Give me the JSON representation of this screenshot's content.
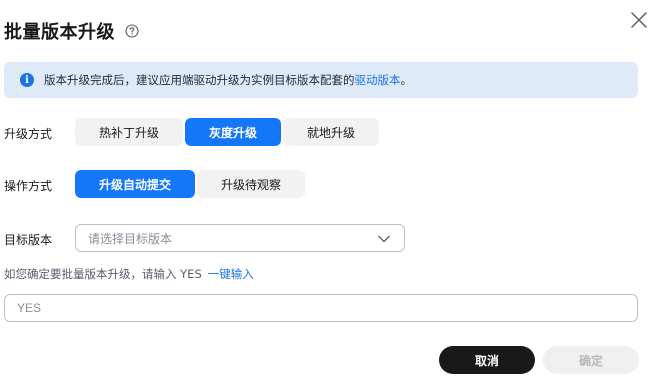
{
  "dialog": {
    "title": "批量版本升级",
    "alert": {
      "text": "版本升级完成后，建议应用端驱动升级为实例目标版本配套的",
      "link": "驱动版本",
      "suffix": "。"
    },
    "upgrade_method": {
      "label": "升级方式",
      "options": [
        "热补丁升级",
        "灰度升级",
        "就地升级"
      ],
      "selected": "灰度升级"
    },
    "operation_method": {
      "label": "操作方式",
      "options": [
        "升级自动提交",
        "升级待观察"
      ],
      "selected": "升级自动提交"
    },
    "target_version": {
      "label": "目标版本",
      "placeholder": "请选择目标版本"
    },
    "confirm": {
      "prompt": "如您确定要批量版本升级，请输入 YES",
      "link": "一键输入",
      "input_placeholder": "YES",
      "input_value": ""
    },
    "buttons": {
      "cancel": "取消",
      "ok": "确定"
    }
  },
  "colors": {
    "primary": "#1477f8",
    "alert_bg": "#dfeaf8",
    "link": "#1a73e8",
    "dark_button": "#191919"
  },
  "icons": [
    "help-icon",
    "close-icon",
    "info-icon",
    "chevron-down-icon"
  ]
}
